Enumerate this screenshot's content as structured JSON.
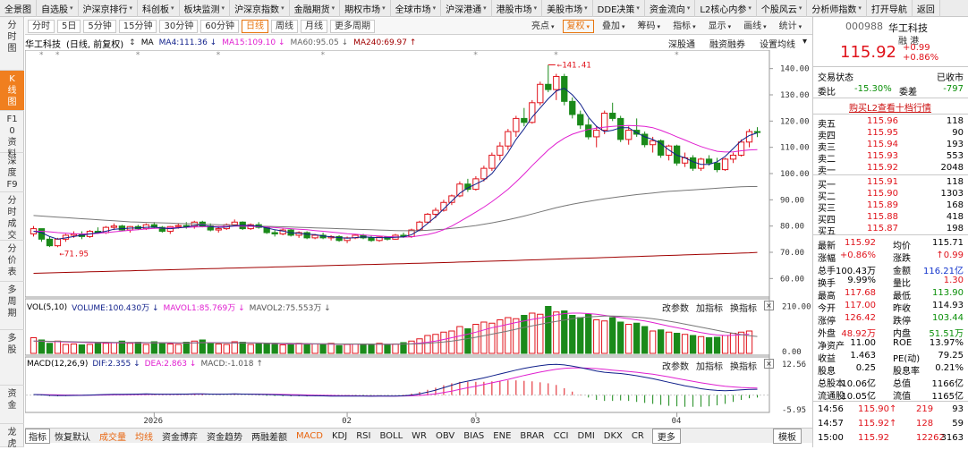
{
  "menu": [
    "全景图",
    "自选股",
    "沪深京排行",
    "科创板",
    "板块监测",
    "沪深京指数",
    "金融期货",
    "期权市场",
    "全球市场",
    "沪深港通",
    "港股市场",
    "美股市场",
    "DDE决策",
    "资金流向",
    "L2核心内参",
    "个股风云",
    "分析师指数",
    "打开导航",
    "返回"
  ],
  "left_tabs": [
    "分时图",
    "K线图",
    "F10资料",
    "深度F9",
    "分时成交",
    "分价表",
    "多周期",
    "多股",
    "资金",
    "龙虎"
  ],
  "periods": [
    "分时",
    "5日",
    "5分钟",
    "15分钟",
    "30分钟",
    "60分钟",
    "日线",
    "周线",
    "月线",
    "更多周期"
  ],
  "toolbar": [
    "亮点",
    "复权",
    "叠加",
    "筹码",
    "指标",
    "显示",
    "画线",
    "统计"
  ],
  "chart_header": {
    "name": "华工科技",
    "mode": "(日线, 前复权)",
    "arrow": "↕",
    "ma_label": "MA",
    "ma4": "MA4:111.36 ↓",
    "ma15": "MA15:109.10 ↓",
    "ma60": "MA60:95.05 ↓",
    "ma240": "MA240:69.97 ↑",
    "links": [
      "深股通",
      "融资融券",
      "设置均线"
    ]
  },
  "vol_header": {
    "title": "VOL(5,10)",
    "volume": "VOLUME:100.430万 ↓",
    "mavol1": "MAVOL1:85.769万 ↓",
    "mavol2": "MAVOL2:75.553万 ↓"
  },
  "macd_header": {
    "title": "MACD(12,26,9)",
    "dif": "DIF:2.355 ↓",
    "dea": "DEA:2.863 ↓",
    "macd": "MACD:-1.018 ↑"
  },
  "panel_controls": [
    "改参数",
    "加指标",
    "换指标"
  ],
  "bottom_tabs": [
    "指标",
    "恢复默认",
    "成交量",
    "均线",
    "资金博弈",
    "资金趋势",
    "两融差额",
    "MACD",
    "KDJ",
    "RSI",
    "BOLL",
    "WR",
    "OBV",
    "BIAS",
    "ENE",
    "BRAR",
    "CCI",
    "DMI",
    "DKX",
    "CR",
    "更多"
  ],
  "bottom_right": "模板",
  "stock": {
    "code": "000988",
    "name": "华工科技",
    "tags": "融 港",
    "price": "115.92",
    "change": "+0.99",
    "pct": "+0.86%",
    "state_label": "交易状态",
    "state": "已收市",
    "wb_label": "委比",
    "wb": "-15.30%",
    "wc_label": "委差",
    "wc": "-797",
    "l2_link": "购买L2查看十档行情"
  },
  "asks": [
    [
      "卖五",
      "115.96",
      "118"
    ],
    [
      "卖四",
      "115.95",
      "90"
    ],
    [
      "卖三",
      "115.94",
      "193"
    ],
    [
      "卖二",
      "115.93",
      "553"
    ],
    [
      "卖一",
      "115.92",
      "2048"
    ]
  ],
  "bids": [
    [
      "买一",
      "115.91",
      "118"
    ],
    [
      "买二",
      "115.90",
      "1303"
    ],
    [
      "买三",
      "115.89",
      "168"
    ],
    [
      "买四",
      "115.88",
      "418"
    ],
    [
      "买五",
      "115.87",
      "198"
    ]
  ],
  "quote": [
    [
      "最新",
      "115.92",
      "均价",
      "115.71"
    ],
    [
      "涨幅",
      "+0.86%",
      "涨跌",
      "↑0.99"
    ],
    [
      "总手",
      "100.43万",
      "金额",
      "116.21亿"
    ],
    [
      "换手",
      "9.99%",
      "量比",
      "1.30"
    ],
    [
      "最高",
      "117.68",
      "最低",
      "113.90"
    ],
    [
      "今开",
      "117.00",
      "昨收",
      "114.93"
    ],
    [
      "涨停",
      "126.42",
      "跌停",
      "103.44"
    ],
    [
      "外盘",
      "48.92万",
      "内盘",
      "51.51万"
    ],
    [
      "净资产",
      "11.00",
      "ROE",
      "13.97%"
    ],
    [
      "收益",
      "1.463",
      "PE(动)",
      "79.25"
    ],
    [
      "股息",
      "0.25",
      "股息率",
      "0.21%"
    ],
    [
      "总股本",
      "10.06亿",
      "总值",
      "1166亿"
    ],
    [
      "流通股",
      "10.05亿",
      "流值",
      "1165亿"
    ]
  ],
  "ticks": [
    [
      "14:56",
      "115.90↑",
      "219",
      "93"
    ],
    [
      "14:57",
      "115.92↑",
      "128",
      "59"
    ],
    [
      "15:00",
      "115.92",
      "12262",
      "3163"
    ]
  ],
  "chart_data": {
    "type": "candlestick",
    "x_ticks": [
      "2026",
      "02",
      "03",
      "04"
    ],
    "price_axis": [
      "140.00",
      "130.00",
      "120.00",
      "110.00",
      "100.00",
      "90.00",
      "80.00",
      "70.00",
      "60.00"
    ],
    "price_ylim": [
      55,
      145
    ],
    "annotations": {
      "high": "141.41",
      "low": "71.95"
    },
    "vol_axis": [
      "210.00",
      "0.00"
    ],
    "macd_axis": [
      "12.56",
      "-5.95"
    ],
    "candles": [
      [
        77,
        80,
        76,
        79
      ],
      [
        79,
        79,
        74,
        75
      ],
      [
        75,
        76,
        72,
        72.5
      ],
      [
        72.5,
        75.5,
        71.95,
        75
      ],
      [
        75,
        77,
        74,
        76.5
      ],
      [
        76.5,
        78,
        75.5,
        77
      ],
      [
        77,
        78,
        75,
        76
      ],
      [
        76,
        78.5,
        75.5,
        78
      ],
      [
        78,
        79.5,
        77,
        77.5
      ],
      [
        77.5,
        80,
        77,
        79.5
      ],
      [
        79.5,
        81,
        78.5,
        80
      ],
      [
        80,
        80.5,
        78,
        78.5
      ],
      [
        78.5,
        80,
        77.5,
        79.8
      ],
      [
        79.8,
        80.5,
        78.5,
        79
      ],
      [
        79,
        81,
        78.5,
        80.5
      ],
      [
        80.5,
        81.5,
        79,
        79.5
      ],
      [
        79.5,
        80,
        77.5,
        78
      ],
      [
        78,
        80,
        77,
        79.8
      ],
      [
        79.8,
        81,
        79,
        80.2
      ],
      [
        80.2,
        81.5,
        79,
        80
      ],
      [
        80,
        82,
        79,
        81.5
      ],
      [
        81.5,
        82,
        79.5,
        80
      ],
      [
        80,
        81,
        78,
        78.5
      ],
      [
        78.5,
        80,
        77.5,
        79
      ],
      [
        79,
        81,
        78.5,
        80.5
      ],
      [
        80.5,
        82.5,
        80,
        81.5
      ],
      [
        81.5,
        81.8,
        78.5,
        79
      ],
      [
        79,
        81,
        78.5,
        80.5
      ],
      [
        80.5,
        81.5,
        79,
        79.5
      ],
      [
        79.5,
        80,
        77,
        77.5
      ],
      [
        77.5,
        78.5,
        76,
        77
      ],
      [
        77,
        79,
        76.5,
        78.5
      ],
      [
        78.5,
        79,
        76,
        76.5
      ],
      [
        76.5,
        78,
        75.5,
        77.5
      ],
      [
        77.5,
        78,
        75,
        75.5
      ],
      [
        75.5,
        77,
        75,
        76.5
      ],
      [
        76.5,
        77.5,
        75,
        75.5
      ],
      [
        75.5,
        76.5,
        74.5,
        76
      ],
      [
        76,
        76.5,
        74,
        74.5
      ],
      [
        74.5,
        76,
        73.5,
        75.5
      ],
      [
        75.5,
        77,
        75,
        76.5
      ],
      [
        76.5,
        77,
        75,
        75.5
      ],
      [
        75.5,
        76.5,
        74,
        74.5
      ],
      [
        74.5,
        76,
        74,
        75.8
      ],
      [
        75.8,
        76,
        74.5,
        75
      ],
      [
        75,
        77,
        74.8,
        76.5
      ],
      [
        76.5,
        77.5,
        75.5,
        76
      ],
      [
        76,
        79,
        75.5,
        78.5
      ],
      [
        78.5,
        82,
        78,
        81.5
      ],
      [
        81.5,
        85,
        81,
        84.5
      ],
      [
        84.5,
        87,
        83,
        86
      ],
      [
        86,
        90,
        85.5,
        89
      ],
      [
        89,
        92,
        88,
        91.5
      ],
      [
        91.5,
        97,
        91,
        96
      ],
      [
        96,
        98,
        93,
        94
      ],
      [
        94,
        99,
        93.5,
        98
      ],
      [
        98,
        103,
        97,
        102
      ],
      [
        102,
        108,
        101,
        107
      ],
      [
        107,
        112,
        105,
        110.5
      ],
      [
        110.5,
        117,
        109,
        116
      ],
      [
        116,
        122,
        114,
        121
      ],
      [
        121,
        125,
        118,
        119.5
      ],
      [
        119.5,
        128,
        119,
        127
      ],
      [
        127,
        135,
        126,
        134
      ],
      [
        134,
        141.41,
        131,
        132
      ],
      [
        132,
        138,
        128,
        137
      ],
      [
        137,
        138,
        126,
        127.5
      ],
      [
        127.5,
        129,
        121,
        122.5
      ],
      [
        122.5,
        124,
        117,
        118.5
      ],
      [
        118.5,
        121,
        113,
        114
      ],
      [
        114,
        118,
        110,
        116.5
      ],
      [
        116.5,
        124,
        115,
        123
      ],
      [
        123,
        127,
        120,
        121
      ],
      [
        121,
        122,
        112,
        113
      ],
      [
        113,
        118,
        111,
        116.5
      ],
      [
        116.5,
        121,
        114,
        115
      ],
      [
        115,
        116,
        110,
        111
      ],
      [
        111,
        114,
        108,
        112.5
      ],
      [
        112.5,
        113,
        106,
        107
      ],
      [
        107,
        111,
        105,
        110.5
      ],
      [
        110.5,
        111,
        103,
        104
      ],
      [
        104,
        108,
        102.5,
        106
      ],
      [
        106,
        107,
        101,
        102
      ],
      [
        102,
        106,
        101,
        105.5
      ],
      [
        105.5,
        107,
        103,
        104
      ],
      [
        104,
        106,
        100.5,
        101.5
      ],
      [
        101.5,
        106,
        101,
        105.5
      ],
      [
        105.5,
        108,
        104,
        107
      ],
      [
        107,
        113,
        106.5,
        112
      ],
      [
        112,
        117,
        110,
        116
      ],
      [
        116,
        117.68,
        113.9,
        115.92
      ]
    ],
    "ma4": [
      78,
      77.5,
      76,
      75,
      75.5,
      76,
      76.5,
      77,
      77.5,
      78,
      78.8,
      79,
      79.2,
      79.3,
      79.5,
      79.6,
      79.2,
      79,
      79.3,
      79.6,
      80.2,
      80.5,
      79.8,
      79.5,
      79.6,
      80.1,
      80.3,
      80.2,
      80,
      79.3,
      78.6,
      78.1,
      77.4,
      77.3,
      76.9,
      76.7,
      76.2,
      75.9,
      75.6,
      75.4,
      75.6,
      75.9,
      75.7,
      75.6,
      75.6,
      75.7,
      75.9,
      76.7,
      78.5,
      81,
      83.5,
      86.5,
      89.5,
      92.5,
      94.5,
      96,
      97.5,
      100,
      104,
      108,
      113,
      117,
      121.5,
      125,
      128.5,
      131.5,
      132.5,
      130,
      126.5,
      121.5,
      118,
      116,
      116.5,
      117.5,
      117.5,
      115.5,
      114,
      113,
      111.5,
      109,
      107,
      106,
      104.5,
      103.5,
      103.5,
      104.5,
      106.5,
      109.5,
      112.5,
      114.5,
      115.5
    ],
    "ma15": [
      78,
      78,
      77.8,
      77.5,
      77.3,
      77.1,
      77,
      77,
      77.2,
      77.5,
      77.8,
      78.1,
      78.4,
      78.6,
      78.9,
      79.1,
      79.2,
      79.3,
      79.4,
      79.5,
      79.6,
      79.7,
      79.8,
      79.8,
      79.9,
      80,
      80,
      79.9,
      79.8,
      79.6,
      79.4,
      79.2,
      79,
      78.8,
      78.6,
      78.3,
      78,
      77.7,
      77.4,
      77.1,
      76.9,
      76.6,
      76.4,
      76.2,
      76,
      75.9,
      75.8,
      75.9,
      76.3,
      76.8,
      77.5,
      78.6,
      80,
      81.7,
      83.5,
      85.3,
      87.2,
      89.3,
      91.6,
      94,
      96.8,
      99.8,
      103,
      106,
      109,
      111.5,
      113.5,
      115,
      116,
      116.8,
      117.3,
      117.7,
      118,
      118.2,
      118.3,
      118.2,
      118,
      117.5,
      116.5,
      115.3,
      114,
      112.8,
      111.5,
      110.3,
      109.3,
      108.5,
      108.2,
      108.3,
      108.7,
      109,
      109.1
    ],
    "ma60": [
      84,
      83.8,
      83.6,
      83.4,
      83.2,
      83,
      82.8,
      82.6,
      82.4,
      82.2,
      82,
      81.8,
      81.6,
      81.5,
      81.4,
      81.3,
      81.2,
      81.1,
      81,
      80.9,
      80.8,
      80.7,
      80.6,
      80.5,
      80.4,
      80.3,
      80.2,
      80.1,
      80,
      79.9,
      79.8,
      79.7,
      79.6,
      79.5,
      79.4,
      79.3,
      79.2,
      79.1,
      79,
      78.9,
      78.8,
      78.7,
      78.6,
      78.5,
      78.4,
      78.3,
      78.2,
      78.2,
      78.3,
      78.4,
      78.6,
      78.8,
      79.1,
      79.4,
      79.8,
      80.2,
      80.7,
      81.2,
      81.8,
      82.4,
      83.1,
      83.8,
      84.6,
      85.4,
      86.2,
      87,
      87.7,
      88.3,
      88.9,
      89.4,
      89.9,
      90.4,
      90.8,
      91.2,
      91.6,
      92,
      92.3,
      92.6,
      92.9,
      93.2,
      93.4,
      93.6,
      93.8,
      94,
      94.2,
      94.4,
      94.6,
      94.8,
      95,
      95.05,
      95.05
    ],
    "ma240": [
      62,
      62.08,
      62.16,
      62.24,
      62.32,
      62.4,
      62.48,
      62.56,
      62.64,
      62.72,
      62.8,
      62.88,
      62.96,
      63.04,
      63.12,
      63.2,
      63.28,
      63.36,
      63.44,
      63.52,
      63.6,
      63.68,
      63.76,
      63.84,
      63.92,
      64,
      64.08,
      64.16,
      64.24,
      64.32,
      64.4,
      64.48,
      64.56,
      64.64,
      64.72,
      64.8,
      64.88,
      64.96,
      65.04,
      65.12,
      65.2,
      65.28,
      65.36,
      65.44,
      65.52,
      65.6,
      65.68,
      65.76,
      65.84,
      65.92,
      66,
      66.09,
      66.18,
      66.27,
      66.36,
      66.45,
      66.54,
      66.63,
      66.72,
      66.81,
      66.9,
      67,
      67.1,
      67.2,
      67.3,
      67.4,
      67.5,
      67.6,
      67.7,
      67.8,
      67.9,
      68,
      68.1,
      68.2,
      68.3,
      68.4,
      68.5,
      68.6,
      68.7,
      68.8,
      68.9,
      69,
      69.1,
      69.2,
      69.3,
      69.4,
      69.5,
      69.6,
      69.7,
      69.8,
      69.97
    ],
    "volume": [
      70,
      60,
      45,
      55,
      40,
      42,
      38,
      40,
      50,
      45,
      48,
      55,
      45,
      50,
      40,
      52,
      48,
      42,
      40,
      50,
      55,
      60,
      45,
      42,
      40,
      52,
      50,
      40,
      42,
      45,
      40,
      38,
      42,
      45,
      40,
      42,
      38,
      45,
      35,
      40,
      42,
      40,
      38,
      45,
      40,
      42,
      48,
      55,
      65,
      80,
      85,
      95,
      100,
      120,
      110,
      130,
      140,
      135,
      150,
      160,
      155,
      170,
      180,
      175,
      210,
      185,
      190,
      170,
      160,
      175,
      150,
      145,
      160,
      140,
      130,
      135,
      120,
      100,
      105,
      95,
      90,
      85,
      80,
      75,
      70,
      72,
      80,
      90,
      95,
      100
    ],
    "mavol1": [
      55,
      54,
      53,
      52,
      51,
      50,
      49,
      48,
      48,
      47,
      47,
      47,
      47,
      47,
      47,
      47,
      47,
      46,
      46,
      46,
      47,
      48,
      48,
      48,
      47,
      47,
      47,
      47,
      46,
      45,
      44,
      43,
      42,
      42,
      42,
      42,
      42,
      41,
      41,
      41,
      41,
      41,
      41,
      41,
      41,
      41,
      42,
      43,
      46,
      50,
      55,
      62,
      70,
      78,
      86,
      95,
      105,
      115,
      122,
      130,
      138,
      145,
      152,
      158,
      165,
      172,
      178,
      180,
      180,
      178,
      175,
      170,
      165,
      160,
      155,
      150,
      145,
      138,
      130,
      122,
      115,
      108,
      100,
      93,
      87,
      82,
      80,
      81,
      83,
      85.769
    ],
    "mavol2": [
      55,
      55,
      54,
      54,
      53,
      52,
      51,
      51,
      50,
      50,
      49,
      49,
      49,
      49,
      48,
      48,
      48,
      48,
      47,
      47,
      47,
      47,
      47,
      47,
      47,
      47,
      47,
      47,
      47,
      46,
      46,
      45,
      45,
      44,
      44,
      43,
      43,
      43,
      42,
      42,
      42,
      42,
      42,
      41,
      41,
      41,
      42,
      42,
      43,
      45,
      48,
      51,
      55,
      60,
      66,
      72,
      79,
      86,
      93,
      100,
      108,
      116,
      123,
      130,
      137,
      143,
      149,
      155,
      160,
      163,
      165,
      167,
      167,
      166,
      164,
      162,
      159,
      155,
      150,
      144,
      138,
      131,
      124,
      117,
      110,
      103,
      96,
      90,
      84,
      79,
      75.553
    ],
    "dif": [
      0.2,
      0.1,
      -0.1,
      -0.2,
      -0.2,
      -0.15,
      -0.1,
      0,
      0.1,
      0.2,
      0.3,
      0.3,
      0.35,
      0.4,
      0.45,
      0.4,
      0.35,
      0.35,
      0.4,
      0.4,
      0.5,
      0.5,
      0.4,
      0.35,
      0.4,
      0.45,
      0.4,
      0.35,
      0.3,
      0.2,
      0.1,
      0,
      -0.1,
      -0.15,
      -0.25,
      -0.3,
      -0.35,
      -0.4,
      -0.45,
      -0.45,
      -0.45,
      -0.45,
      -0.5,
      -0.45,
      -0.45,
      -0.4,
      -0.3,
      0,
      0.5,
      1.2,
      2,
      3,
      4,
      5,
      5.7,
      6.3,
      7,
      7.8,
      8.6,
      9.4,
      10.2,
      10.9,
      11.5,
      12,
      12.4,
      12.56,
      12.3,
      11.8,
      11.2,
      10.5,
      9.8,
      9.3,
      9,
      8.8,
      8.4,
      7.9,
      7.3,
      6.7,
      6,
      5.2,
      4.5,
      3.8,
      3.2,
      2.6,
      2.2,
      1.9,
      1.8,
      1.9,
      2.1,
      2.3,
      2.355
    ],
    "dea": [
      0.2,
      0.18,
      0.12,
      0.06,
      0.01,
      -0.02,
      -0.04,
      -0.03,
      0,
      0.04,
      0.09,
      0.13,
      0.17,
      0.22,
      0.26,
      0.29,
      0.3,
      0.31,
      0.33,
      0.34,
      0.37,
      0.39,
      0.39,
      0.38,
      0.39,
      0.4,
      0.4,
      0.39,
      0.37,
      0.34,
      0.29,
      0.23,
      0.16,
      0.1,
      0.03,
      -0.04,
      -0.1,
      -0.16,
      -0.22,
      -0.27,
      -0.31,
      -0.34,
      -0.37,
      -0.39,
      -0.4,
      -0.4,
      -0.38,
      -0.3,
      -0.14,
      0.13,
      0.5,
      1,
      1.6,
      2.3,
      3,
      3.6,
      4.3,
      5,
      5.7,
      6.4,
      7.2,
      8,
      8.7,
      9.4,
      10,
      10.5,
      10.9,
      11.1,
      11.1,
      11,
      10.8,
      10.5,
      10.2,
      9.9,
      9.6,
      9.3,
      8.9,
      8.5,
      8,
      7.4,
      6.8,
      6.2,
      5.6,
      5,
      4.5,
      4,
      3.6,
      3.3,
      3.1,
      2.95,
      2.863
    ]
  }
}
